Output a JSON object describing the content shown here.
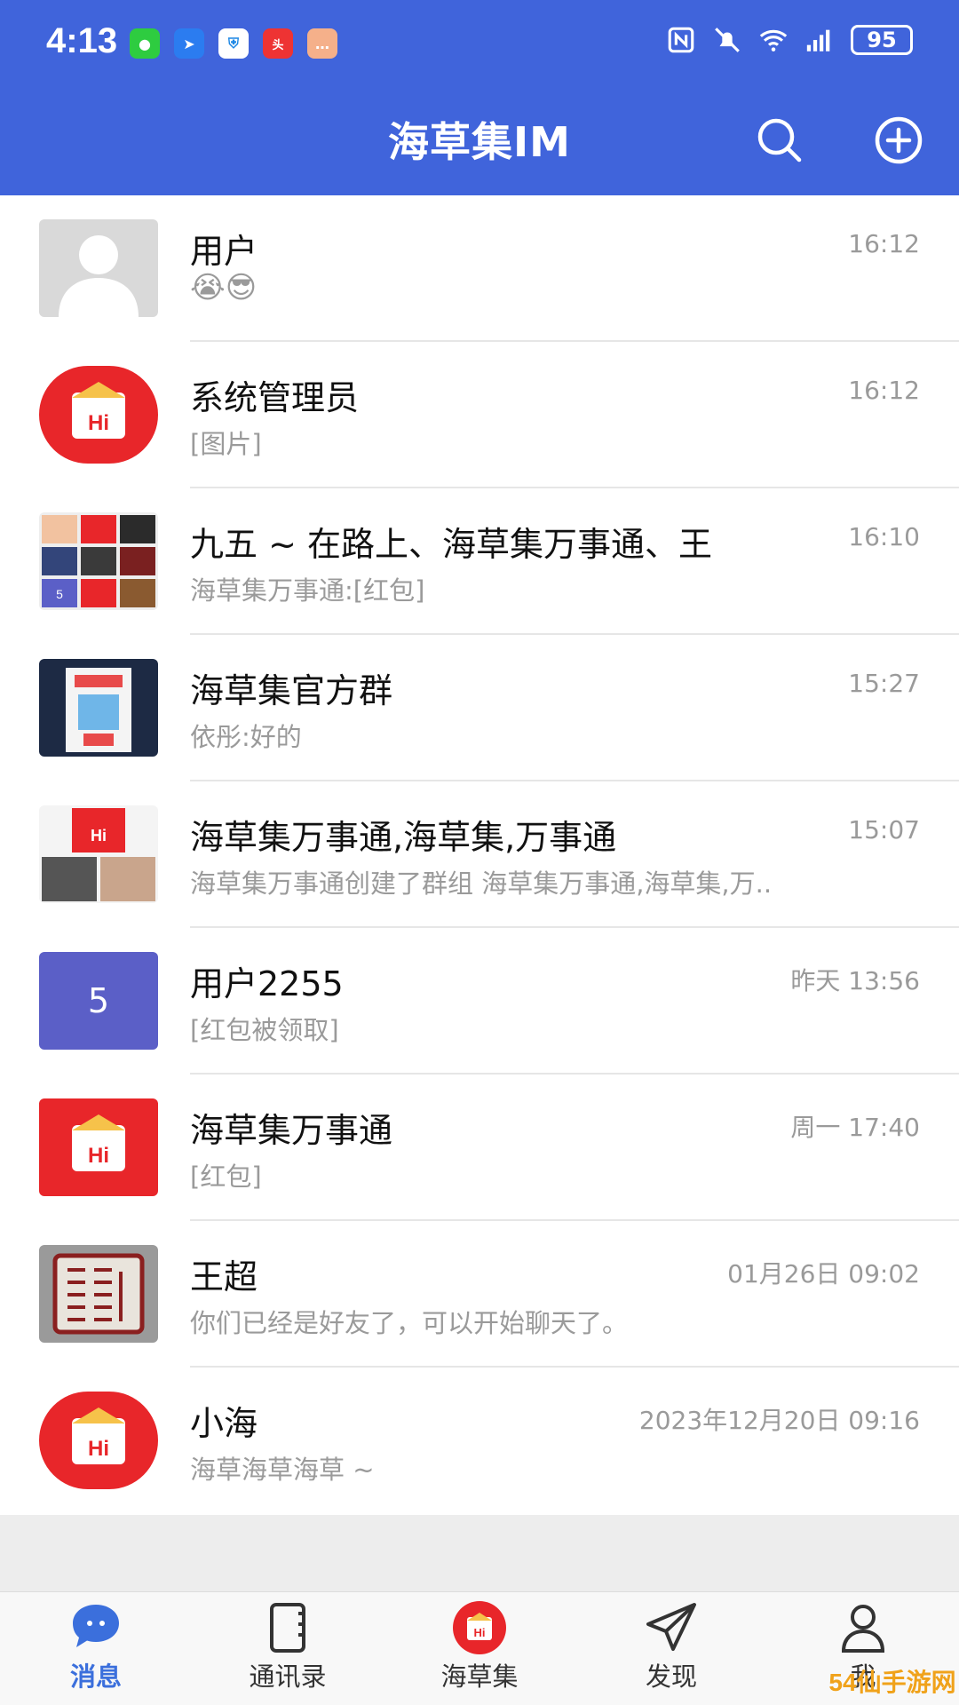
{
  "status_bar": {
    "time": "4:13",
    "battery": "95"
  },
  "header": {
    "title": "海草集IM"
  },
  "colors": {
    "header_bg": "#4064db",
    "accent": "#3b6fdc",
    "hi_red": "#e8262a",
    "purple_avatar": "#5b5fc7"
  },
  "conversations": [
    {
      "name": "用户",
      "message": "😭😎",
      "time": "16:12",
      "avatar": "default-avatar"
    },
    {
      "name": "系统管理员",
      "message": "[图片]",
      "time": "16:12",
      "avatar": "hi-logo-round"
    },
    {
      "name": "九五 ~ 在路上、海草集万事通、王",
      "message": "海草集万事通:[红包]",
      "time": "16:10",
      "avatar": "group-grid"
    },
    {
      "name": "海草集官方群",
      "message": "依彤:好的",
      "time": "15:27",
      "avatar": "photo-poster"
    },
    {
      "name": "海草集万事通,海草集,万事通",
      "message": "海草集万事通创建了群组 海草集万事通,海草集,万..",
      "time": "15:07",
      "avatar": "group-grid-small"
    },
    {
      "name": "用户2255",
      "message": "[红包被领取]",
      "time": "昨天 13:56",
      "avatar": "letter-avatar",
      "avatar_text": "5"
    },
    {
      "name": "海草集万事通",
      "message": "[红包]",
      "time": "周一 17:40",
      "avatar": "hi-logo-square"
    },
    {
      "name": "王超",
      "message": "你们已经是好友了，可以开始聊天了。",
      "time": "01月26日 09:02",
      "avatar": "seal-stamp"
    },
    {
      "name": "小海",
      "message": "海草海草海草 ~",
      "time": "2023年12月20日 09:16",
      "avatar": "hi-logo-round"
    }
  ],
  "tabs": [
    {
      "label": "消息",
      "icon": "chat-bubble-icon",
      "active": true
    },
    {
      "label": "通讯录",
      "icon": "contacts-icon",
      "active": false
    },
    {
      "label": "海草集",
      "icon": "hi-logo-icon",
      "active": false
    },
    {
      "label": "发现",
      "icon": "paper-plane-icon",
      "active": false
    },
    {
      "label": "我",
      "icon": "user-icon",
      "active": false
    }
  ],
  "watermark": "54仙手游网"
}
